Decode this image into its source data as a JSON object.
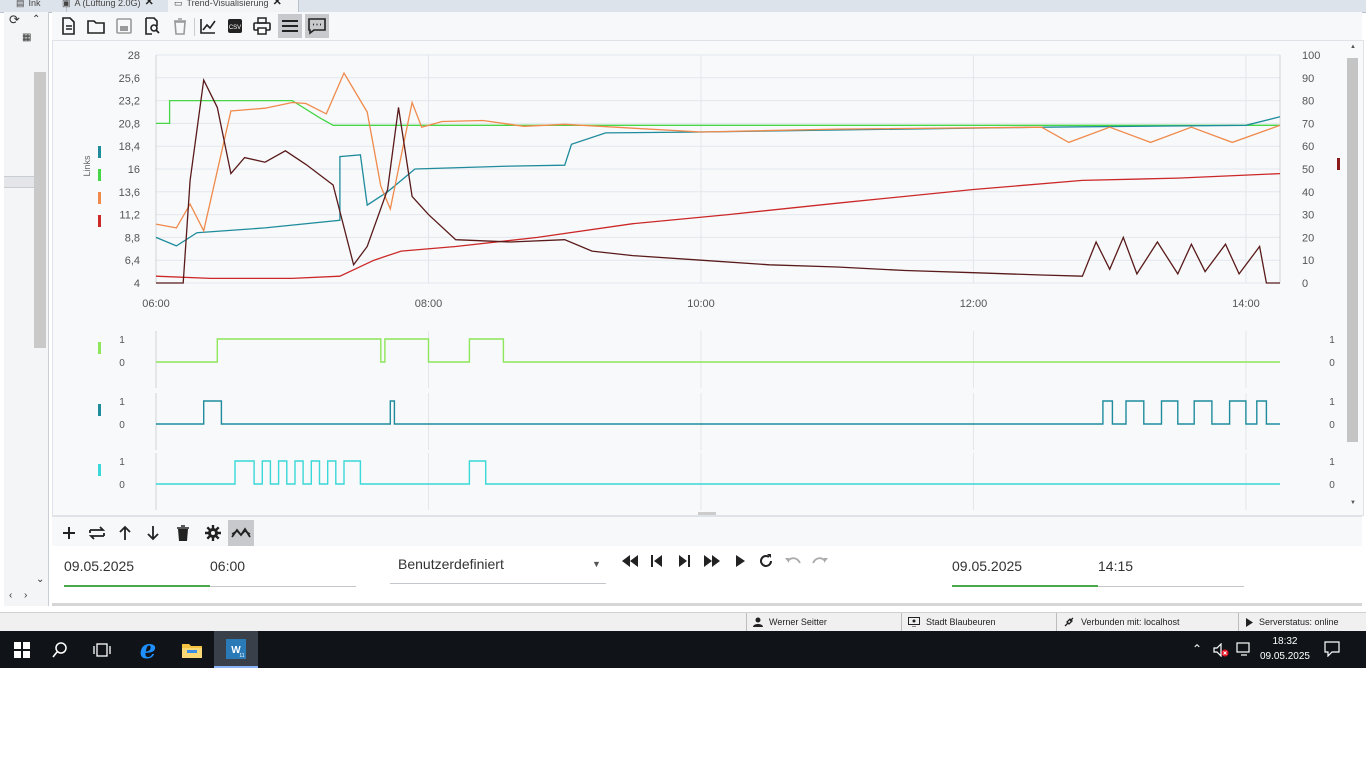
{
  "tabs": [
    {
      "label": "Ink",
      "active": false
    },
    {
      "label": "A (Lüftung 2.0G)",
      "active": false
    },
    {
      "label": "Trend-Visualisierung",
      "active": true
    }
  ],
  "left_panel": {
    "icons": [
      "refresh-icon",
      "chevron-up-icon",
      "tree-node-icon",
      "chevron-down-icon",
      "scroll-left-icon",
      "scroll-right-icon"
    ]
  },
  "toolbar": {
    "buttons": [
      {
        "name": "new-document",
        "icon": "document-icon"
      },
      {
        "name": "open-folder",
        "icon": "folder-icon"
      },
      {
        "name": "save",
        "icon": "save-icon",
        "disabled": true
      },
      {
        "name": "search-document",
        "icon": "search-document-icon"
      },
      {
        "name": "delete",
        "icon": "trash-icon",
        "disabled": true
      },
      {
        "name": "chart",
        "icon": "chart-line-icon"
      },
      {
        "name": "export-csv",
        "icon": "csv-icon"
      },
      {
        "name": "print",
        "icon": "print-icon"
      },
      {
        "name": "legend",
        "icon": "menu-lines-icon",
        "active": true
      },
      {
        "name": "comments",
        "icon": "comment-icon",
        "active": true
      }
    ]
  },
  "main_chart": {
    "type": "line",
    "left_axis_label": "Links",
    "left_ticks": [
      "28",
      "25,6",
      "23,2",
      "20,8",
      "18,4",
      "16",
      "13,6",
      "11,2",
      "8,8",
      "6,4",
      "4"
    ],
    "right_ticks": [
      "100",
      "90",
      "80",
      "70",
      "60",
      "50",
      "40",
      "30",
      "20",
      "10",
      "0"
    ],
    "x_ticks": [
      "06:00",
      "08:00",
      "10:00",
      "12:00",
      "14:00"
    ],
    "left_range": [
      4,
      28
    ],
    "right_range": [
      0,
      100
    ],
    "x_range_hours": [
      6.0,
      14.25
    ],
    "series_colors": {
      "teal": "#1f8c9c",
      "green": "#46d646",
      "orange": "#f08a4b",
      "red": "#cc2828",
      "brown": "#5a1a1a"
    },
    "legend_markers": [
      "#1f8c9c",
      "#46d646",
      "#f08a4b",
      "#cc2828"
    ],
    "right_marker": "#8b1a1a"
  },
  "chart_data": [
    {
      "type": "line",
      "title": "",
      "xlabel": "",
      "ylabel": "Links",
      "ylim": [
        4,
        28
      ],
      "y2lim": [
        0,
        100
      ],
      "x_unit": "time of day",
      "series": [
        {
          "color": "#46d646",
          "axis": "left",
          "points": [
            [
              6.0,
              20.8
            ],
            [
              6.1,
              20.8
            ],
            [
              6.1,
              23.2
            ],
            [
              7.0,
              23.2
            ],
            [
              7.2,
              21.4
            ],
            [
              7.3,
              20.6
            ],
            [
              14.25,
              20.6
            ]
          ]
        },
        {
          "color": "#1f8c9c",
          "axis": "left",
          "points": [
            [
              6.0,
              8.8
            ],
            [
              6.15,
              7.9
            ],
            [
              6.3,
              9.3
            ],
            [
              6.8,
              9.8
            ],
            [
              7.35,
              10.6
            ],
            [
              7.35,
              17.3
            ],
            [
              7.5,
              17.5
            ],
            [
              7.55,
              12.2
            ],
            [
              7.7,
              13.6
            ],
            [
              7.9,
              16.0
            ],
            [
              8.6,
              16.3
            ],
            [
              9.0,
              16.4
            ],
            [
              9.05,
              18.6
            ],
            [
              9.3,
              19.8
            ],
            [
              10.0,
              19.9
            ],
            [
              11.0,
              20.1
            ],
            [
              12.5,
              20.4
            ],
            [
              14.0,
              20.6
            ],
            [
              14.25,
              21.5
            ]
          ]
        },
        {
          "color": "#f08a4b",
          "axis": "left",
          "points": [
            [
              6.0,
              10.2
            ],
            [
              6.15,
              9.8
            ],
            [
              6.25,
              12.3
            ],
            [
              6.35,
              9.5
            ],
            [
              6.55,
              22.1
            ],
            [
              6.8,
              22.4
            ],
            [
              7.0,
              23.0
            ],
            [
              7.1,
              22.9
            ],
            [
              7.25,
              21.8
            ],
            [
              7.38,
              26.1
            ],
            [
              7.55,
              22.0
            ],
            [
              7.65,
              14.2
            ],
            [
              7.72,
              11.8
            ],
            [
              7.88,
              23.0
            ],
            [
              7.95,
              20.4
            ],
            [
              8.1,
              21.0
            ],
            [
              8.4,
              21.1
            ],
            [
              8.7,
              20.5
            ],
            [
              9.0,
              20.7
            ],
            [
              9.5,
              20.3
            ],
            [
              10.0,
              19.9
            ],
            [
              11.0,
              20.2
            ],
            [
              12.5,
              20.4
            ],
            [
              12.7,
              18.8
            ],
            [
              13.0,
              20.4
            ],
            [
              13.3,
              18.8
            ],
            [
              13.6,
              20.4
            ],
            [
              13.9,
              18.8
            ],
            [
              14.25,
              20.6
            ]
          ]
        },
        {
          "color": "#cc2828",
          "axis": "right",
          "points": [
            [
              6.0,
              3.0
            ],
            [
              6.4,
              2.0
            ],
            [
              7.0,
              2.0
            ],
            [
              7.35,
              3.0
            ],
            [
              7.6,
              10.0
            ],
            [
              7.8,
              14.0
            ],
            [
              8.2,
              16.0
            ],
            [
              8.8,
              20.0
            ],
            [
              9.5,
              26.0
            ],
            [
              10.2,
              30.0
            ],
            [
              11.0,
              35.0
            ],
            [
              12.0,
              41.0
            ],
            [
              12.8,
              45.0
            ],
            [
              13.5,
              46.0
            ],
            [
              14.25,
              48.0
            ]
          ]
        },
        {
          "color": "#5a1a1a",
          "axis": "right",
          "points": [
            [
              6.0,
              0
            ],
            [
              6.2,
              0
            ],
            [
              6.25,
              45.0
            ],
            [
              6.35,
              89.0
            ],
            [
              6.45,
              77.0
            ],
            [
              6.55,
              48.0
            ],
            [
              6.65,
              55.0
            ],
            [
              6.8,
              53.0
            ],
            [
              6.95,
              58.0
            ],
            [
              7.1,
              52.0
            ],
            [
              7.3,
              43.0
            ],
            [
              7.45,
              8.0
            ],
            [
              7.55,
              16.0
            ],
            [
              7.7,
              41.0
            ],
            [
              7.78,
              77.0
            ],
            [
              7.88,
              38.0
            ],
            [
              8.0,
              30.0
            ],
            [
              8.2,
              19.0
            ],
            [
              8.6,
              18.0
            ],
            [
              9.0,
              19.0
            ],
            [
              9.2,
              14.0
            ],
            [
              9.5,
              12.0
            ],
            [
              10.0,
              10.0
            ],
            [
              10.5,
              8.0
            ],
            [
              11.0,
              7.0
            ],
            [
              11.5,
              5.5
            ],
            [
              12.0,
              4.5
            ],
            [
              12.5,
              3.5
            ],
            [
              12.8,
              3.0
            ],
            [
              12.9,
              18.0
            ],
            [
              13.0,
              6.0
            ],
            [
              13.1,
              20.0
            ],
            [
              13.2,
              4.0
            ],
            [
              13.35,
              18.0
            ],
            [
              13.5,
              4.0
            ],
            [
              13.6,
              17.0
            ],
            [
              13.7,
              5.0
            ],
            [
              13.85,
              17.0
            ],
            [
              13.95,
              4.0
            ],
            [
              14.1,
              16.0
            ],
            [
              14.15,
              0.0
            ],
            [
              14.25,
              0.0
            ]
          ]
        }
      ]
    },
    {
      "type": "line",
      "title": "",
      "ylim": [
        0,
        1
      ],
      "yticks": [
        "1",
        "0"
      ],
      "color": "#8ee65a",
      "marker_color": "#8ee65a",
      "steps": [
        [
          6.0,
          0
        ],
        [
          6.45,
          1
        ],
        [
          7.65,
          0
        ],
        [
          7.68,
          1
        ],
        [
          8.0,
          0
        ],
        [
          8.3,
          1
        ],
        [
          8.55,
          0
        ],
        [
          14.25,
          0
        ]
      ]
    },
    {
      "type": "line",
      "title": "",
      "ylim": [
        0,
        1
      ],
      "yticks": [
        "1",
        "0"
      ],
      "color": "#1f8c9c",
      "marker_color": "#1f8c9c",
      "steps": [
        [
          6.0,
          0
        ],
        [
          6.35,
          1
        ],
        [
          6.48,
          0
        ],
        [
          7.72,
          1
        ],
        [
          7.75,
          0
        ],
        [
          12.95,
          1
        ],
        [
          13.02,
          0
        ],
        [
          13.12,
          1
        ],
        [
          13.25,
          0
        ],
        [
          13.38,
          1
        ],
        [
          13.5,
          0
        ],
        [
          13.62,
          1
        ],
        [
          13.75,
          0
        ],
        [
          13.88,
          1
        ],
        [
          14.0,
          0
        ],
        [
          14.08,
          1
        ],
        [
          14.15,
          0
        ],
        [
          14.25,
          0
        ]
      ]
    },
    {
      "type": "line",
      "title": "",
      "ylim": [
        0,
        1
      ],
      "yticks": [
        "1",
        "0"
      ],
      "color": "#3ad8d8",
      "marker_color": "#3ad8d8",
      "steps": [
        [
          6.0,
          0
        ],
        [
          6.58,
          1
        ],
        [
          6.72,
          0
        ],
        [
          6.78,
          1
        ],
        [
          6.84,
          0
        ],
        [
          6.9,
          1
        ],
        [
          6.96,
          0
        ],
        [
          7.02,
          1
        ],
        [
          7.08,
          0
        ],
        [
          7.14,
          1
        ],
        [
          7.2,
          0
        ],
        [
          7.26,
          1
        ],
        [
          7.32,
          0
        ],
        [
          7.38,
          1
        ],
        [
          7.5,
          0
        ],
        [
          8.3,
          1
        ],
        [
          8.42,
          0
        ],
        [
          14.25,
          0
        ]
      ]
    }
  ],
  "bottom_toolbar": {
    "buttons": [
      {
        "name": "add",
        "icon": "plus-icon"
      },
      {
        "name": "swap",
        "icon": "swap-icon"
      },
      {
        "name": "move-up",
        "icon": "arrow-up-icon"
      },
      {
        "name": "move-down",
        "icon": "arrow-down-icon"
      },
      {
        "name": "delete-series",
        "icon": "trash-icon"
      },
      {
        "name": "settings",
        "icon": "gear-icon"
      },
      {
        "name": "trend",
        "icon": "trend-icon",
        "active": true
      }
    ]
  },
  "controls": {
    "start_date": "09.05.2025",
    "start_time": "06:00",
    "range_select": "Benutzerdefiniert",
    "end_date": "09.05.2025",
    "end_time": "14:15"
  },
  "status": {
    "user": "Werner Seitter",
    "location": "Stadt Blaubeuren",
    "connection": "Verbunden mit: localhost",
    "server": "Serverstatus: online"
  },
  "taskbar": {
    "time": "18:32",
    "date": "09.05.2025",
    "apps": [
      "windows-start-icon",
      "search-icon",
      "task-view-icon",
      "edge-icon",
      "file-explorer-icon",
      "app-w11-icon"
    ]
  }
}
